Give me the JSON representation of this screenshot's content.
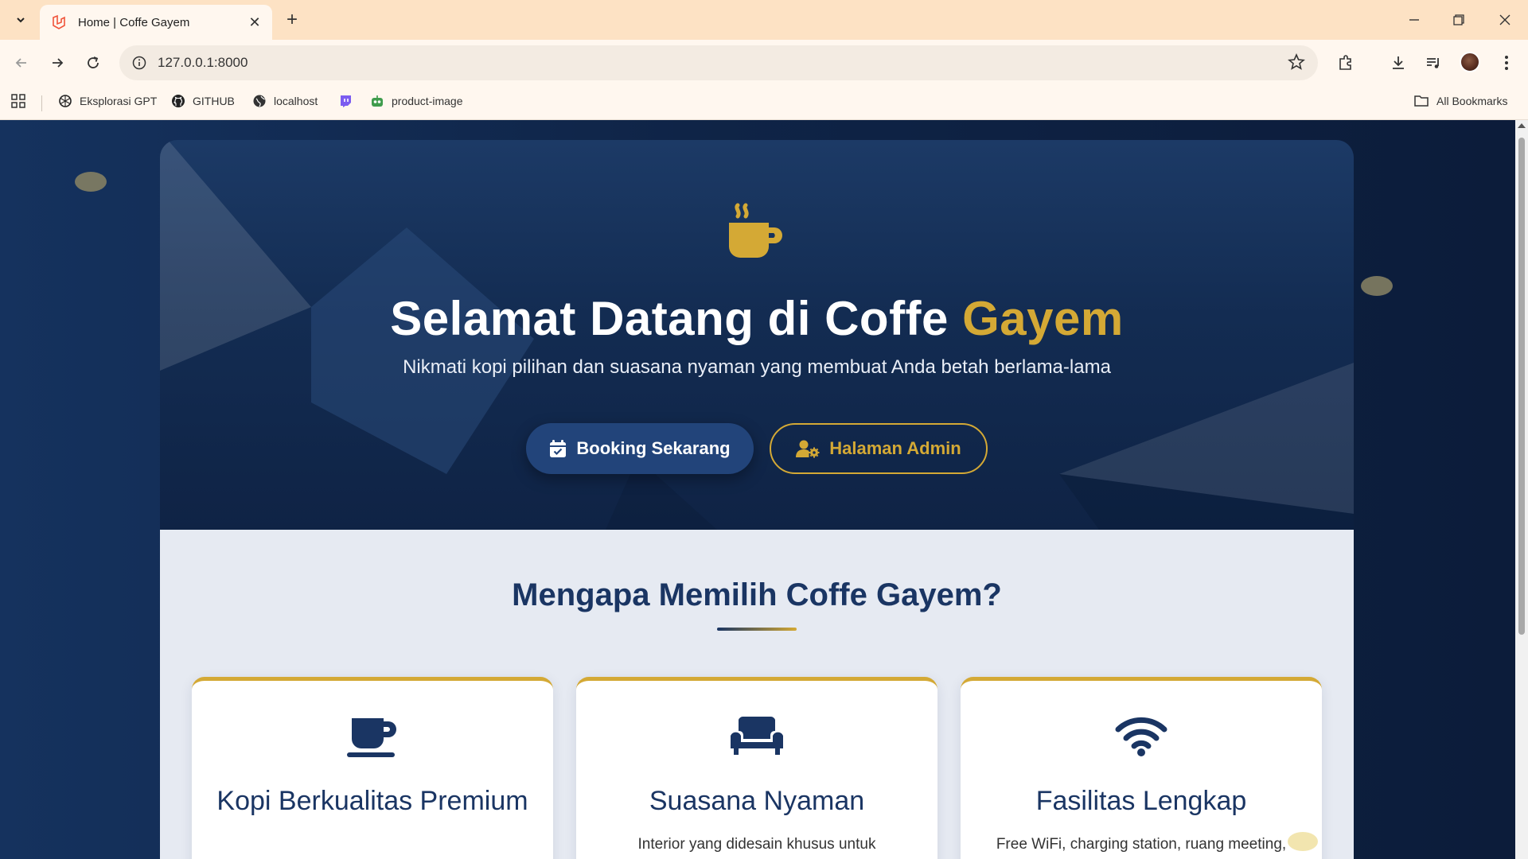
{
  "browser": {
    "tab_title": "Home | Coffe Gayem",
    "url": "127.0.0.1:8000",
    "bookmarks": [
      "Eksplorasi GPT",
      "GITHUB",
      "localhost",
      "product-image"
    ],
    "all_bookmarks": "All Bookmarks"
  },
  "hero": {
    "title_main": "Selamat Datang di Coffe",
    "title_accent": "Gayem",
    "subtitle": "Nikmati kopi pilihan dan suasana nyaman yang membuat Anda betah berlama-lama",
    "booking_label": "Booking Sekarang",
    "admin_label": "Halaman Admin"
  },
  "features": {
    "title": "Mengapa Memilih Coffe Gayem?",
    "cards": [
      {
        "icon": "mug-icon",
        "title": "Kopi Berkualitas Premium",
        "desc": ""
      },
      {
        "icon": "couch-icon",
        "title": "Suasana Nyaman",
        "desc": "Interior yang didesain khusus untuk"
      },
      {
        "icon": "wifi-icon",
        "title": "Fasilitas Lengkap",
        "desc": "Free WiFi, charging station, ruang meeting,"
      }
    ]
  },
  "colors": {
    "navy": "#1a3563",
    "gold": "#d4a935",
    "tabstrip": "#fde2c4"
  }
}
